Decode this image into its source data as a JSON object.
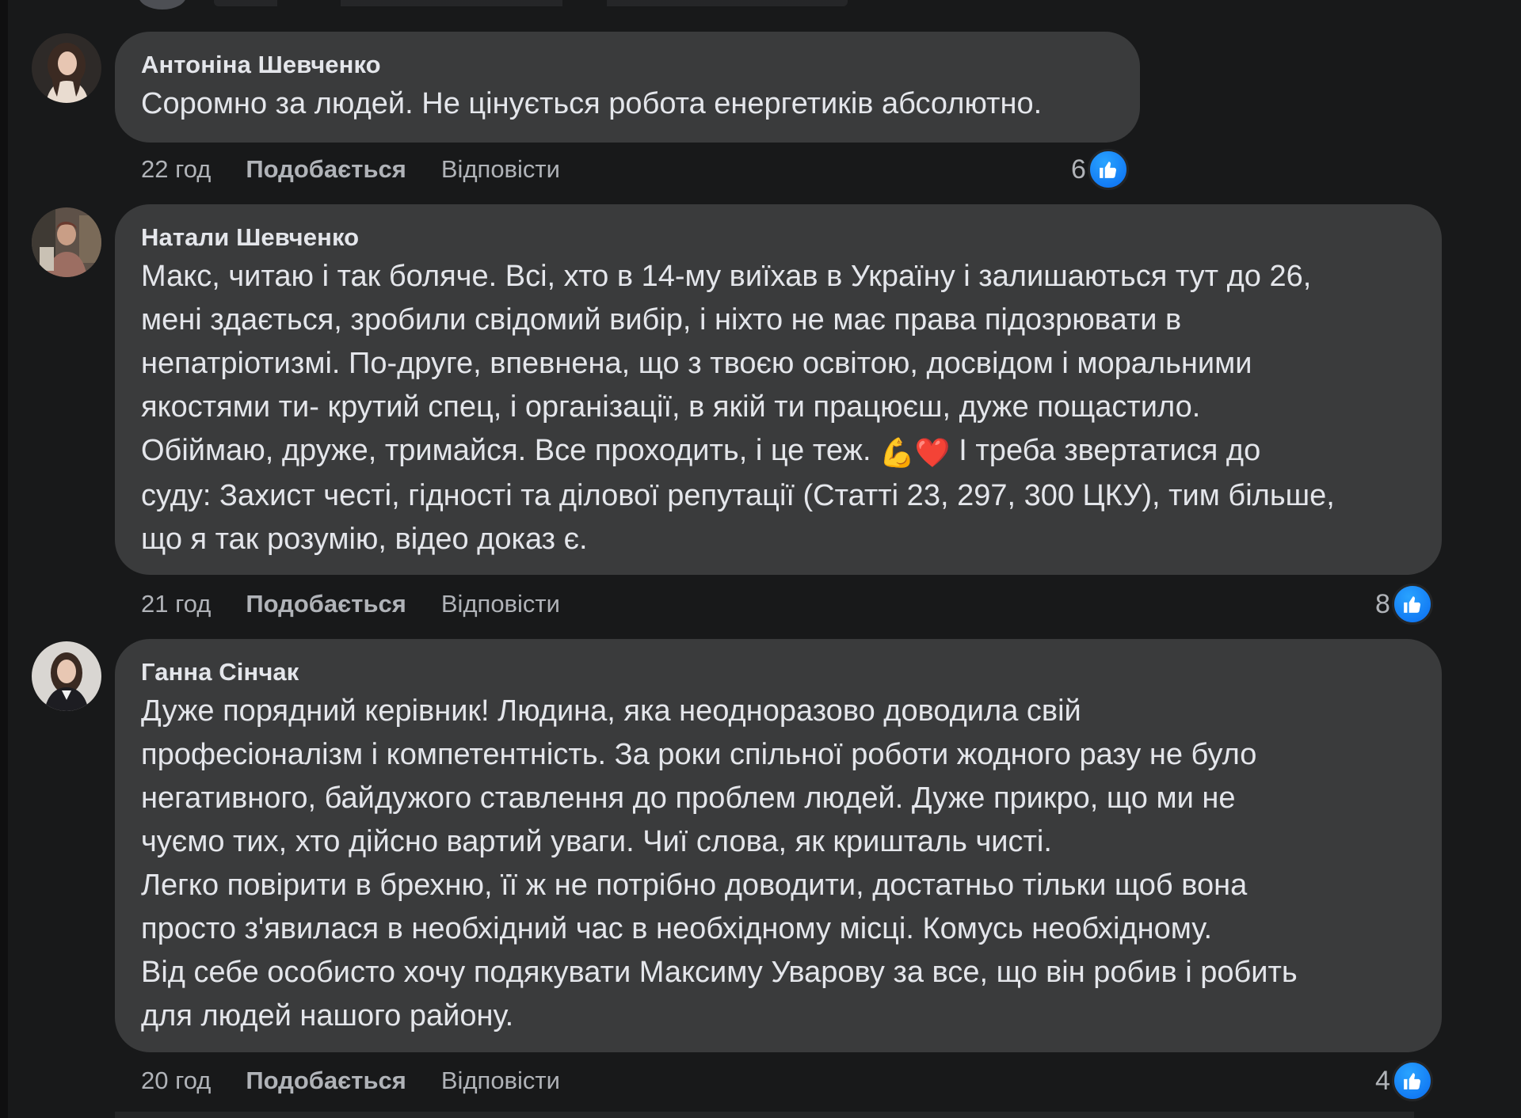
{
  "comments": [
    {
      "author": "Антоніна Шевченко",
      "text": "Соромно за людей. Не цінується робота енергетиків абсолютно.",
      "time": "22 год",
      "like_label": "Подобається",
      "reply_label": "Відповісти",
      "reaction_count": "6",
      "reaction_icon": "thumbs-up-icon"
    },
    {
      "author": "Натали Шевченко",
      "text_before_emoji": "Макс, читаю і так боляче. Всі, хто в 14-му виїхав в Україну і залишаються тут до 26,\nмені здається, зробили свідомий вибір, і ніхто не має права підозрювати в\nнепатріотизмі. По-друге, впевнена, що з твоєю освітою, досвідом і моральними\nякостями ти- крутий спец, і організації, в якій ти працюєш, дуже пощастило.\nОбіймаю, друже, тримайся. Все проходить, і це теж. ",
      "emoji": "💪❤️",
      "text_after_emoji": " І треба звертатися до\nсуду: Захист честі, гідності та ділової репутації (Статті 23, 297, 300 ЦКУ), тим більше,\nщо я так розумію, відео доказ є.",
      "time": "21 год",
      "like_label": "Подобається",
      "reply_label": "Відповісти",
      "reaction_count": "8",
      "reaction_icon": "thumbs-up-icon"
    },
    {
      "author": "Ганна Сінчак",
      "text": "Дуже порядний керівник! Людина, яка неодноразово доводила свій\nпрофесіоналізм і компетентність. За роки спільної роботи жодного разу не було\nнегативного, байдужого ставлення до проблем людей. Дуже прикро, що ми не\nчуємо тих, хто дійсно вартий уваги. Чиї слова, як кришталь чисті.\nЛегко повірити в брехню, її ж не потрібно доводити, достатньо тільки щоб вона\nпросто з'явилася в необхідний час в необхідному місці. Комусь необхідному.\nВід себе особисто хочу подякувати Максиму Уварову за все, що він робив і робить\nдля людей нашого району.",
      "time": "20 год",
      "like_label": "Подобається",
      "reply_label": "Відповісти",
      "reaction_count": "4",
      "reaction_icon": "thumbs-up-icon"
    }
  ],
  "colors": {
    "background": "#18191a",
    "bubble": "#3a3b3c",
    "text": "#e4e6eb",
    "muted": "#b0b3b8",
    "like_blue": "#1877f2"
  }
}
